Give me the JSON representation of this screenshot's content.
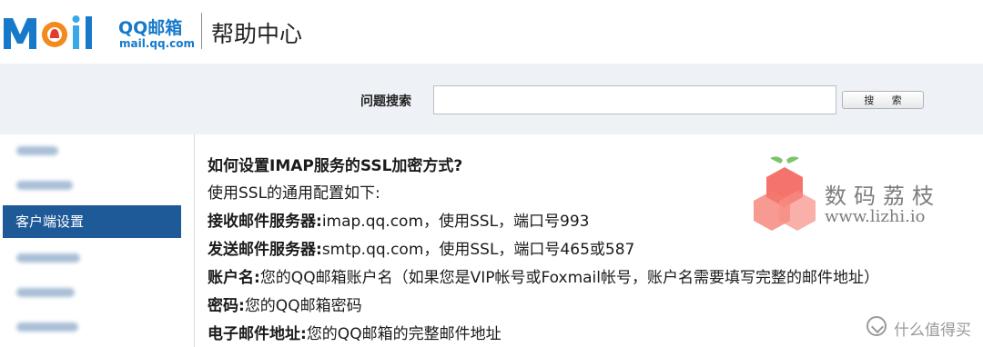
{
  "header": {
    "logo_mail": "Mail",
    "logo_cn": "QQ邮箱",
    "logo_en": "mail.qq.com",
    "title": "帮助中心"
  },
  "search": {
    "label": "问题搜索",
    "value": "",
    "placeholder": "",
    "button": "搜 索"
  },
  "sidebar": {
    "items": [
      {
        "label": "",
        "blurred": true,
        "active": false
      },
      {
        "label": "",
        "blurred": true,
        "active": false
      },
      {
        "label": "客户端设置",
        "blurred": false,
        "active": true
      },
      {
        "label": "",
        "blurred": true,
        "active": false
      },
      {
        "label": "",
        "blurred": true,
        "active": false
      },
      {
        "label": "",
        "blurred": true,
        "active": false
      }
    ]
  },
  "article": {
    "title": "如何设置IMAP服务的SSL加密方式?",
    "intro": "使用SSL的通用配置如下:",
    "rows": [
      {
        "key": "接收邮件服务器:",
        "value": "imap.qq.com，使用SSL，端口号993"
      },
      {
        "key": "发送邮件服务器:",
        "value": "smtp.qq.com，使用SSL，端口号465或587"
      },
      {
        "key": "账户名:",
        "value": "您的QQ邮箱账户名（如果您是VIP帐号或Foxmail帐号，账户名需要填写完整的邮件地址）"
      },
      {
        "key": "密码:",
        "value": "您的QQ邮箱密码"
      },
      {
        "key": "电子邮件地址:",
        "value": "您的QQ邮箱的完整邮件地址"
      }
    ]
  },
  "watermark": {
    "text": "数码荔枝",
    "url": "www.lizhi.io"
  },
  "footer_brand": {
    "text": "什么值得买"
  },
  "colors": {
    "brand_blue": "#1679c9",
    "sidebar_active": "#1f5a98",
    "search_band": "#eef2f6"
  }
}
